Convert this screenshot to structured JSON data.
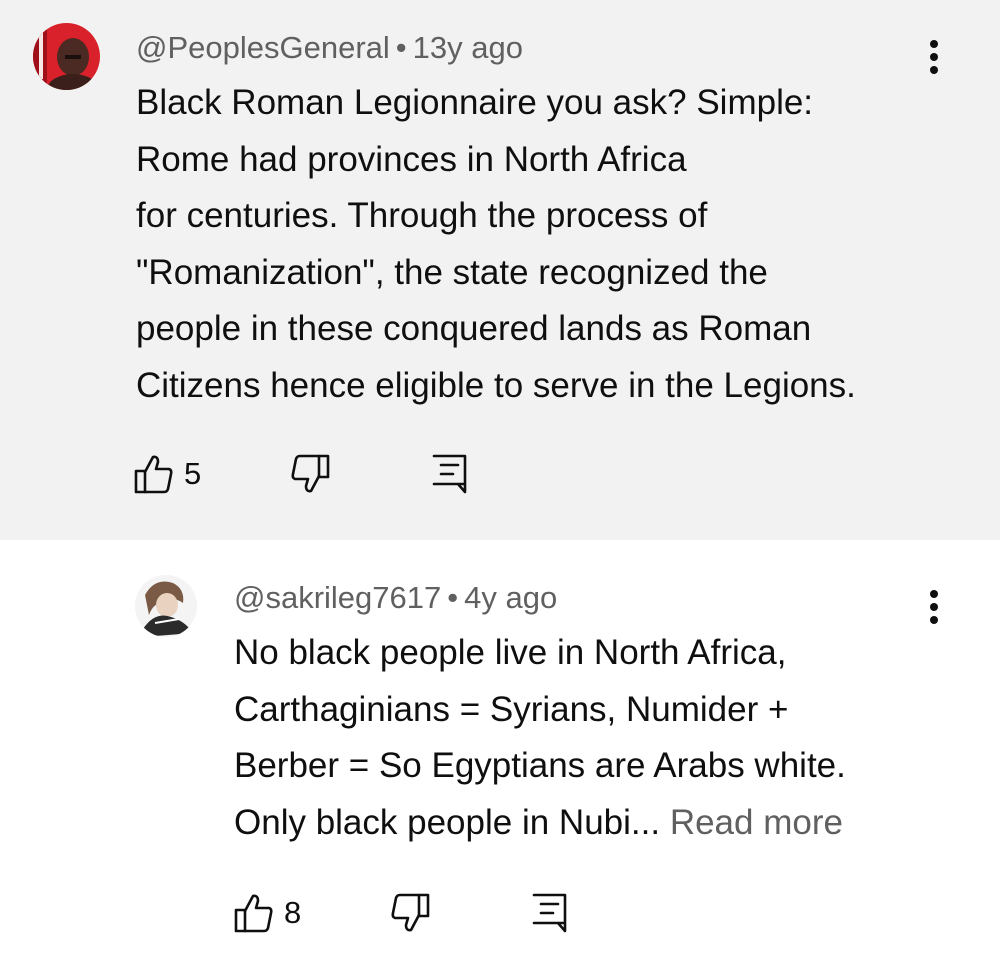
{
  "comments": [
    {
      "author": "@PeoplesGeneral",
      "separator": "•",
      "time": "13y ago",
      "lines": [
        "Black Roman Legionnaire you ask? Simple:",
        "Rome had provinces in North Africa",
        "for centuries. Through the process of",
        "\"Romanization\", the state recognized the",
        "people in these conquered lands as Roman",
        "Citizens hence eligible to serve in the Legions."
      ],
      "likes": "5",
      "icons": {
        "like": "thumbs-up-icon",
        "dislike": "thumbs-down-icon",
        "reply": "reply-comment-icon",
        "menu": "more-vert-icon"
      },
      "background": "#f2f2f2"
    },
    {
      "author": "@sakrileg7617",
      "separator": "•",
      "time": "4y ago",
      "lines": [
        "No black people live in North Africa,",
        "Carthaginians = Syrians, Numider +",
        "Berber = So Egyptians are Arabs white."
      ],
      "last_line": "Only black people in Nubi...",
      "read_more": "Read more",
      "likes": "8",
      "icons": {
        "like": "thumbs-up-icon",
        "dislike": "thumbs-down-icon",
        "reply": "reply-comment-icon",
        "menu": "more-vert-icon"
      },
      "background": "#ffffff"
    }
  ],
  "colors": {
    "text_primary": "#0f0f0f",
    "text_secondary": "#606060",
    "highlight_bg": "#f2f2f2"
  }
}
